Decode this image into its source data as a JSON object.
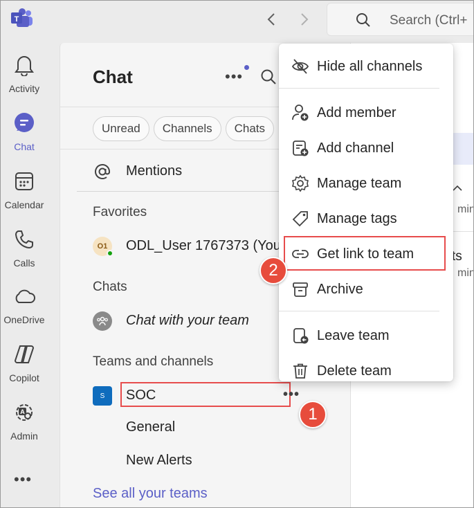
{
  "header": {
    "search_placeholder": "Search (Ctrl+"
  },
  "rail": {
    "items": [
      {
        "label": "Activity"
      },
      {
        "label": "Chat"
      },
      {
        "label": "Calendar"
      },
      {
        "label": "Calls"
      },
      {
        "label": "OneDrive"
      },
      {
        "label": "Copilot"
      },
      {
        "label": "Admin"
      }
    ],
    "more": "•••"
  },
  "chat_panel": {
    "title": "Chat",
    "more": "•••",
    "filters": [
      "Unread",
      "Channels",
      "Chats"
    ],
    "mentions": "Mentions",
    "sections": {
      "favorites": "Favorites",
      "chats": "Chats",
      "teams": "Teams and channels"
    },
    "favorite_item": {
      "initials": "O1",
      "name": "ODL_User 1767373 (You)"
    },
    "chat_item": "Chat with your team",
    "team": {
      "badge": "S",
      "name": "SOC",
      "more": "•••"
    },
    "channels": [
      "General",
      "New Alerts"
    ],
    "see_all": "See all your teams"
  },
  "right_pane": {
    "texts": [
      "min",
      "ts",
      "min"
    ]
  },
  "context_menu": {
    "items": [
      {
        "label": "Hide all channels",
        "icon": "eye-off-icon"
      },
      {
        "label": "Add member",
        "icon": "person-add-icon"
      },
      {
        "label": "Add channel",
        "icon": "channel-add-icon"
      },
      {
        "label": "Manage team",
        "icon": "gear-icon"
      },
      {
        "label": "Manage tags",
        "icon": "tag-icon"
      },
      {
        "label": "Get link to team",
        "icon": "link-icon"
      },
      {
        "label": "Archive",
        "icon": "archive-icon"
      },
      {
        "label": "Leave team",
        "icon": "leave-icon"
      },
      {
        "label": "Delete team",
        "icon": "trash-icon"
      }
    ]
  },
  "callouts": [
    "1",
    "2"
  ],
  "colors": {
    "accent": "#5b5fc7",
    "highlight": "#e74c4c",
    "callout": "#e74c3c"
  }
}
